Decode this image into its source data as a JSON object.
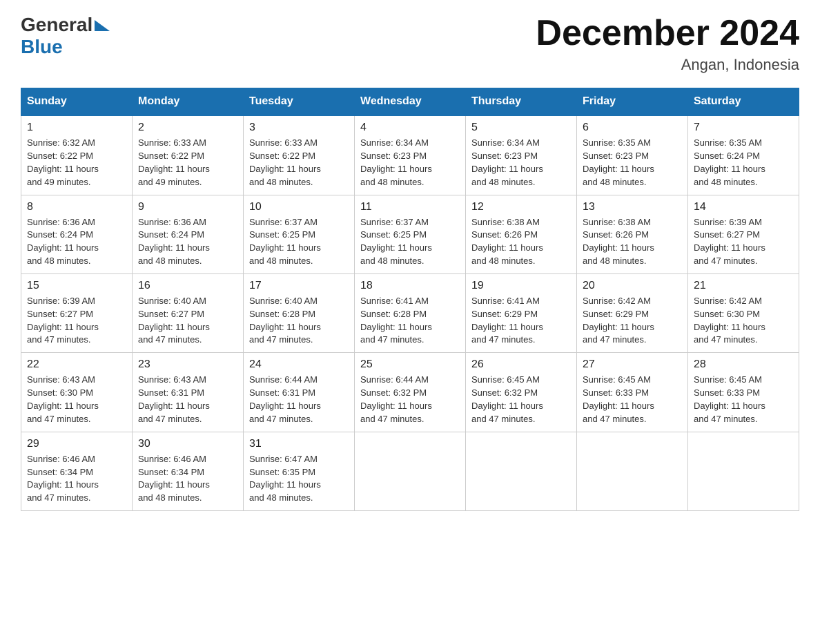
{
  "header": {
    "logo_general": "General",
    "logo_blue": "Blue",
    "title": "December 2024",
    "subtitle": "Angan, Indonesia"
  },
  "weekdays": [
    "Sunday",
    "Monday",
    "Tuesday",
    "Wednesday",
    "Thursday",
    "Friday",
    "Saturday"
  ],
  "weeks": [
    [
      {
        "day": "1",
        "sunrise": "6:32 AM",
        "sunset": "6:22 PM",
        "daylight": "11 hours and 49 minutes."
      },
      {
        "day": "2",
        "sunrise": "6:33 AM",
        "sunset": "6:22 PM",
        "daylight": "11 hours and 49 minutes."
      },
      {
        "day": "3",
        "sunrise": "6:33 AM",
        "sunset": "6:22 PM",
        "daylight": "11 hours and 48 minutes."
      },
      {
        "day": "4",
        "sunrise": "6:34 AM",
        "sunset": "6:23 PM",
        "daylight": "11 hours and 48 minutes."
      },
      {
        "day": "5",
        "sunrise": "6:34 AM",
        "sunset": "6:23 PM",
        "daylight": "11 hours and 48 minutes."
      },
      {
        "day": "6",
        "sunrise": "6:35 AM",
        "sunset": "6:23 PM",
        "daylight": "11 hours and 48 minutes."
      },
      {
        "day": "7",
        "sunrise": "6:35 AM",
        "sunset": "6:24 PM",
        "daylight": "11 hours and 48 minutes."
      }
    ],
    [
      {
        "day": "8",
        "sunrise": "6:36 AM",
        "sunset": "6:24 PM",
        "daylight": "11 hours and 48 minutes."
      },
      {
        "day": "9",
        "sunrise": "6:36 AM",
        "sunset": "6:24 PM",
        "daylight": "11 hours and 48 minutes."
      },
      {
        "day": "10",
        "sunrise": "6:37 AM",
        "sunset": "6:25 PM",
        "daylight": "11 hours and 48 minutes."
      },
      {
        "day": "11",
        "sunrise": "6:37 AM",
        "sunset": "6:25 PM",
        "daylight": "11 hours and 48 minutes."
      },
      {
        "day": "12",
        "sunrise": "6:38 AM",
        "sunset": "6:26 PM",
        "daylight": "11 hours and 48 minutes."
      },
      {
        "day": "13",
        "sunrise": "6:38 AM",
        "sunset": "6:26 PM",
        "daylight": "11 hours and 48 minutes."
      },
      {
        "day": "14",
        "sunrise": "6:39 AM",
        "sunset": "6:27 PM",
        "daylight": "11 hours and 47 minutes."
      }
    ],
    [
      {
        "day": "15",
        "sunrise": "6:39 AM",
        "sunset": "6:27 PM",
        "daylight": "11 hours and 47 minutes."
      },
      {
        "day": "16",
        "sunrise": "6:40 AM",
        "sunset": "6:27 PM",
        "daylight": "11 hours and 47 minutes."
      },
      {
        "day": "17",
        "sunrise": "6:40 AM",
        "sunset": "6:28 PM",
        "daylight": "11 hours and 47 minutes."
      },
      {
        "day": "18",
        "sunrise": "6:41 AM",
        "sunset": "6:28 PM",
        "daylight": "11 hours and 47 minutes."
      },
      {
        "day": "19",
        "sunrise": "6:41 AM",
        "sunset": "6:29 PM",
        "daylight": "11 hours and 47 minutes."
      },
      {
        "day": "20",
        "sunrise": "6:42 AM",
        "sunset": "6:29 PM",
        "daylight": "11 hours and 47 minutes."
      },
      {
        "day": "21",
        "sunrise": "6:42 AM",
        "sunset": "6:30 PM",
        "daylight": "11 hours and 47 minutes."
      }
    ],
    [
      {
        "day": "22",
        "sunrise": "6:43 AM",
        "sunset": "6:30 PM",
        "daylight": "11 hours and 47 minutes."
      },
      {
        "day": "23",
        "sunrise": "6:43 AM",
        "sunset": "6:31 PM",
        "daylight": "11 hours and 47 minutes."
      },
      {
        "day": "24",
        "sunrise": "6:44 AM",
        "sunset": "6:31 PM",
        "daylight": "11 hours and 47 minutes."
      },
      {
        "day": "25",
        "sunrise": "6:44 AM",
        "sunset": "6:32 PM",
        "daylight": "11 hours and 47 minutes."
      },
      {
        "day": "26",
        "sunrise": "6:45 AM",
        "sunset": "6:32 PM",
        "daylight": "11 hours and 47 minutes."
      },
      {
        "day": "27",
        "sunrise": "6:45 AM",
        "sunset": "6:33 PM",
        "daylight": "11 hours and 47 minutes."
      },
      {
        "day": "28",
        "sunrise": "6:45 AM",
        "sunset": "6:33 PM",
        "daylight": "11 hours and 47 minutes."
      }
    ],
    [
      {
        "day": "29",
        "sunrise": "6:46 AM",
        "sunset": "6:34 PM",
        "daylight": "11 hours and 47 minutes."
      },
      {
        "day": "30",
        "sunrise": "6:46 AM",
        "sunset": "6:34 PM",
        "daylight": "11 hours and 48 minutes."
      },
      {
        "day": "31",
        "sunrise": "6:47 AM",
        "sunset": "6:35 PM",
        "daylight": "11 hours and 48 minutes."
      },
      null,
      null,
      null,
      null
    ]
  ],
  "labels": {
    "sunrise": "Sunrise:",
    "sunset": "Sunset:",
    "daylight": "Daylight:"
  }
}
